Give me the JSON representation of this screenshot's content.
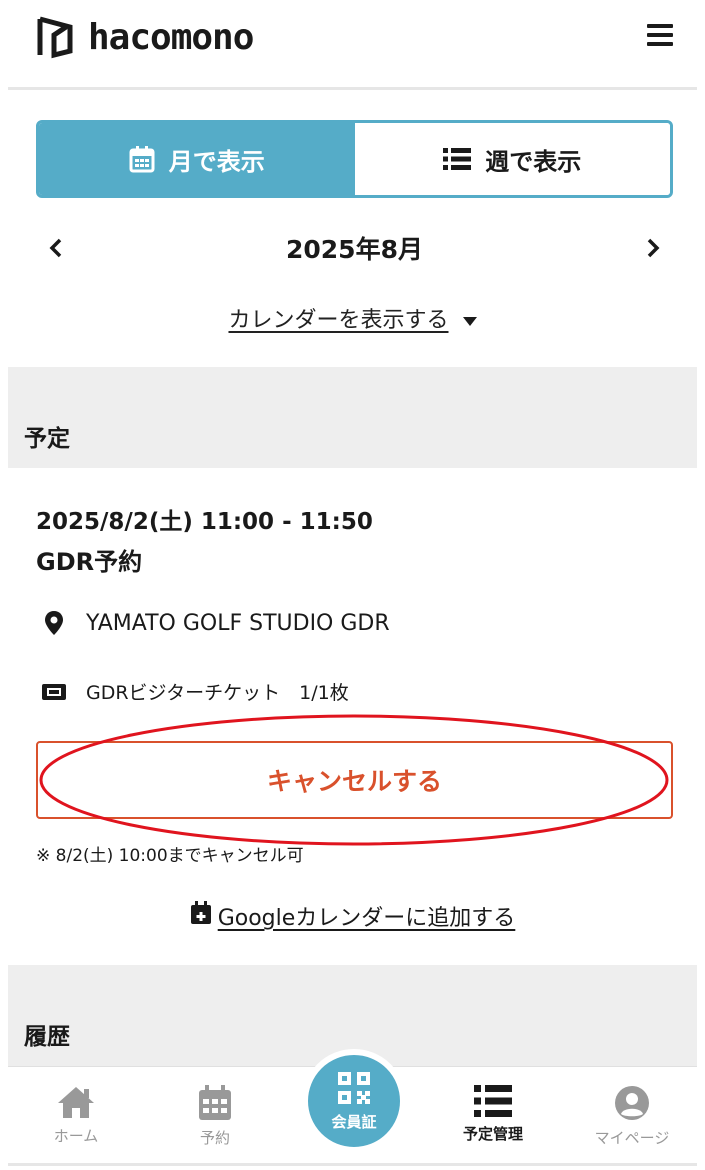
{
  "header": {
    "logo_text": "hacomono"
  },
  "view_toggle": {
    "month_label": "月で表示",
    "week_label": "週で表示"
  },
  "month_nav": {
    "current_month": "2025年8月"
  },
  "show_calendar_label": "カレンダーを表示する",
  "sections": {
    "schedule_title": "予定",
    "history_title": "履歴"
  },
  "event": {
    "datetime": "2025/8/2(土) 11:00 - 11:50",
    "name": "GDR予約",
    "location": "YAMATO GOLF STUDIO  GDR",
    "ticket": "GDRビジターチケット　1/1枚",
    "cancel_label": "キャンセルする",
    "cancel_note": "※ 8/2(土) 10:00までキャンセル可",
    "google_calendar_label": "Googleカレンダーに追加する"
  },
  "bottom_nav": {
    "home": "ホーム",
    "reserve": "予約",
    "member_card": "会員証",
    "schedule_manage": "予定管理",
    "mypage": "マイページ"
  },
  "colors": {
    "accent": "#55acc8",
    "cancel": "#d9512c",
    "annotation": "#e0141e"
  }
}
